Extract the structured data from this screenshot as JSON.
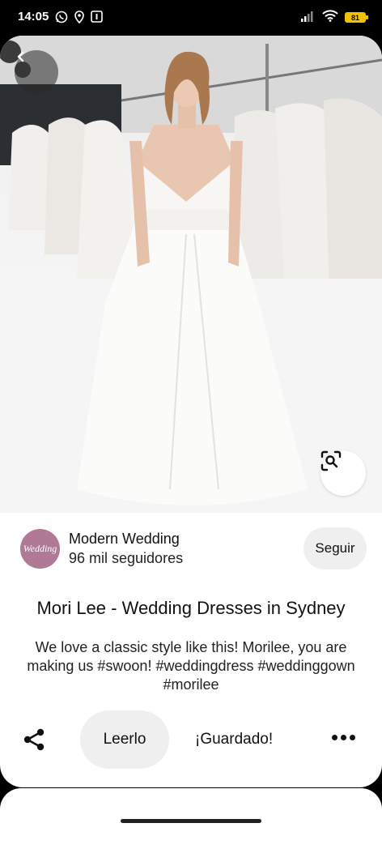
{
  "status_bar": {
    "time": "14:05",
    "battery": "81"
  },
  "pin": {
    "creator_name": "Modern Wedding",
    "creator_followers": "96 mil seguidores",
    "avatar_text": "Wedding",
    "follow_label": "Seguir",
    "title": "Mori Lee - Wedding Dresses in Sydney",
    "description": "We love a classic style like this! Morilee, you are making us #swoon! #weddingdress #weddinggown #morilee"
  },
  "actions": {
    "read_label": "Leerlo",
    "saved_label": "¡Guardado!"
  },
  "icons": {
    "back": "chevron-left-icon",
    "lens": "visual-search-icon",
    "share": "share-icon",
    "more": "more-horizontal-icon"
  }
}
